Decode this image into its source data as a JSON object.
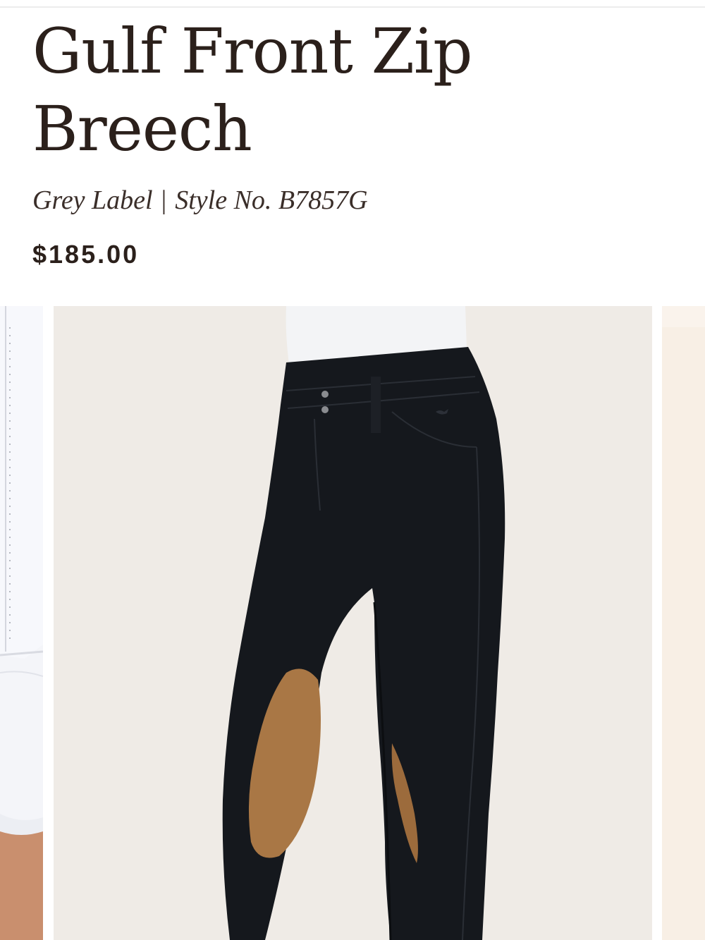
{
  "product": {
    "title": "Gulf Front Zip Breech",
    "brand": "Grey Label",
    "separator": "|",
    "style_label": "Style No. B7857G",
    "price": "$185.00"
  },
  "gallery": {
    "images": [
      {
        "subject": "white shirt with zip front (partial)"
      },
      {
        "subject": "black breeches with tan knee patches"
      },
      {
        "subject": "next image (partial)"
      }
    ]
  },
  "colors": {
    "text": "#2b201b",
    "image_bg": "#efebe6",
    "breech": "#15181d",
    "knee_patch": "#a97745"
  }
}
